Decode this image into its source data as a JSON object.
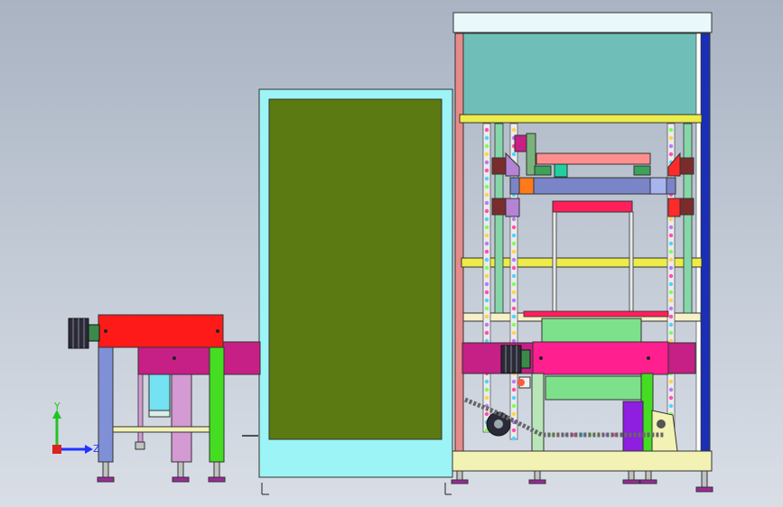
{
  "viewport": {
    "background_top": "#a9b3c2",
    "background_bottom": "#d9dee6"
  },
  "triad": {
    "y_label": "Y",
    "z_label": "Z",
    "y_color": "#22c422",
    "z_color": "#2233ff",
    "x_color": "#dd2222"
  },
  "colors": {
    "frame_top_panel": "#6fbfb8",
    "frame_top_bar": "#e8f8fb",
    "frame_left_post": "#e78a8a",
    "frame_right_post": "#1a2fb5",
    "yellow_bar": "#ecec4a",
    "cabinet_outer": "#9cf4f6",
    "cabinet_inner": "#5c7a12",
    "conveyor_red": "#ff1a1a",
    "conveyor_magenta": "#c61f85",
    "leg_blue": "#7f90d6",
    "leg_green": "#44dd22",
    "leg_pink": "#d39ad3",
    "cylinder": "#74e2f2",
    "hot_pink": "#ff1f8f",
    "light_green": "#7de08a",
    "purple": "#8e1ee0",
    "base_yellow": "#f2f2b4",
    "motor_dark": "#2a2a3a"
  }
}
